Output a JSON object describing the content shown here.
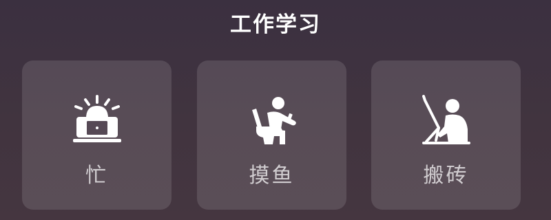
{
  "section": {
    "title": "工作学习"
  },
  "cards": [
    {
      "label": "忙",
      "icon": "busy-alarm-laptop-icon"
    },
    {
      "label": "摸鱼",
      "icon": "slacking-toilet-phone-icon"
    },
    {
      "label": "搬砖",
      "icon": "working-person-desk-icon"
    }
  ],
  "colors": {
    "title": "#ffffff",
    "label": "#c8c0c6",
    "icon": "#ffffff",
    "card": "#5a4d58"
  }
}
